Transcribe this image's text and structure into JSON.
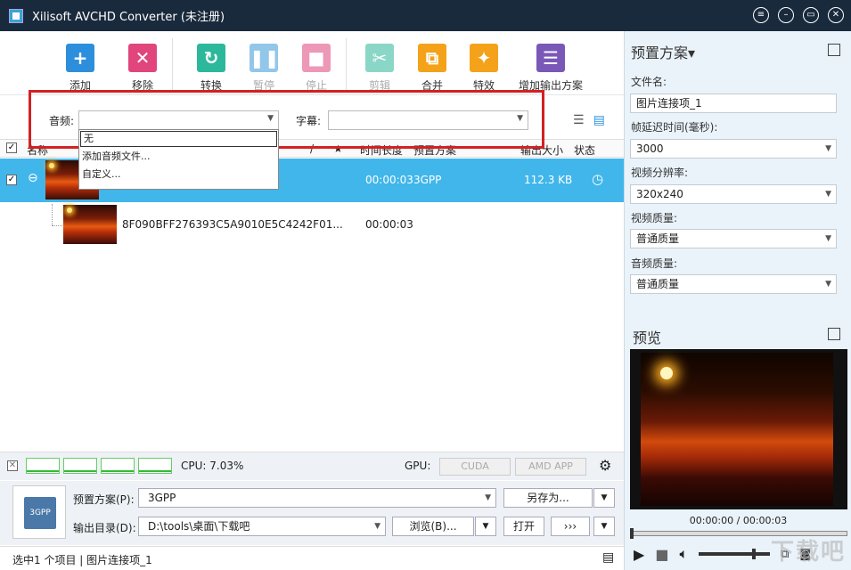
{
  "window": {
    "title": "Xilisoft AVCHD Converter (未注册)"
  },
  "toolbar": {
    "add": "添加",
    "remove": "移除",
    "convert": "转换",
    "pause": "暂停",
    "stop": "停止",
    "clip": "剪辑",
    "merge": "合并",
    "effects": "特效",
    "add_profile": "增加输出方案"
  },
  "filters": {
    "audio_label": "音频:",
    "subtitle_label": "字幕:",
    "audio_value": "",
    "subtitle_value": ""
  },
  "audio_dropdown": {
    "selected": "无",
    "items": [
      "添加音频文件...",
      "自定义..."
    ]
  },
  "columns": {
    "name": "名称",
    "edit": "/",
    "star": "★",
    "duration": "时间长度",
    "profile": "预置方案",
    "size": "输出大小",
    "status": "状态"
  },
  "rows": [
    {
      "name": "",
      "duration": "00:00:03",
      "profile": "3GPP",
      "size": "112.3 KB",
      "checked": "✓",
      "collapse": "⊖",
      "status_icon": "clock-icon"
    },
    {
      "name": "8F090BFF276393C5A9010E5C4242F01...",
      "duration": "00:00:03"
    }
  ],
  "panel": {
    "title": "预置方案▾",
    "filename_label": "文件名:",
    "filename": "图片连接项_1",
    "delay_label": "帧延迟时间(毫秒):",
    "delay": "3000",
    "resolution_label": "视频分辨率:",
    "resolution": "320x240",
    "vquality_label": "视频质量:",
    "vquality": "普通质量",
    "aquality_label": "音频质量:",
    "aquality": "普通质量"
  },
  "preview": {
    "title": "预览",
    "time": "00:00:00 / 00:00:03"
  },
  "cpu": {
    "label": "CPU: 7.03%",
    "gpu_label": "GPU:",
    "cuda": "CUDA",
    "amd": "AMD APP"
  },
  "bottom": {
    "profile_label": "预置方案(P):",
    "profile": "3GPP",
    "save_as": "另存为...",
    "output_label": "输出目录(D):",
    "output": "D:\\tools\\桌面\\下载吧",
    "browse": "浏览(B)...",
    "open": "打开",
    "convert_arrows": "›››",
    "format_icon_text": "3GPP"
  },
  "status": {
    "text": "选中1 个项目 | 图片连接项_1"
  },
  "watermark": "下载吧",
  "colors": {
    "selection": "#41b6ea",
    "titlebar": "#1a2a3d",
    "highlight_box": "#d32121"
  }
}
